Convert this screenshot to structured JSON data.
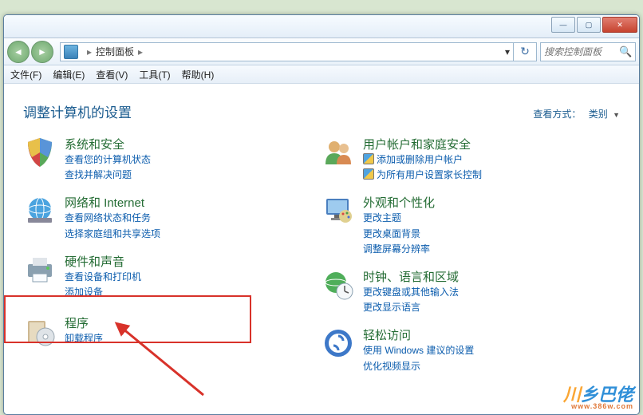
{
  "titlebar": {
    "min": "—",
    "max": "▢",
    "close": "✕"
  },
  "nav": {
    "back": "◄",
    "forward": "►",
    "path_root": "控制面板",
    "path_sep": "▸",
    "dropdown": "▾",
    "refresh": "↻",
    "search_placeholder": "搜索控制面板",
    "search_icon": "🔍"
  },
  "menu": {
    "file": "文件(F)",
    "edit": "编辑(E)",
    "view": "查看(V)",
    "tools": "工具(T)",
    "help": "帮助(H)"
  },
  "header": {
    "title": "调整计算机的设置",
    "view_label": "查看方式：",
    "view_mode": "类别",
    "dd": "▼"
  },
  "cats": {
    "system": {
      "title": "系统和安全",
      "sub1": "查看您的计算机状态",
      "sub2": "查找并解决问题"
    },
    "network": {
      "title": "网络和 Internet",
      "sub1": "查看网络状态和任务",
      "sub2": "选择家庭组和共享选项"
    },
    "hardware": {
      "title": "硬件和声音",
      "sub1": "查看设备和打印机",
      "sub2": "添加设备"
    },
    "programs": {
      "title": "程序",
      "sub1": "卸载程序"
    },
    "users": {
      "title": "用户帐户和家庭安全",
      "sub1": "添加或删除用户帐户",
      "sub2": "为所有用户设置家长控制"
    },
    "appearance": {
      "title": "外观和个性化",
      "sub1": "更改主题",
      "sub2": "更改桌面背景",
      "sub3": "调整屏幕分辨率"
    },
    "clock": {
      "title": "时钟、语言和区域",
      "sub1": "更改键盘或其他输入法",
      "sub2": "更改显示语言"
    },
    "ease": {
      "title": "轻松访问",
      "sub1": "使用 Windows 建议的设置",
      "sub2": "优化视频显示"
    }
  },
  "watermark": {
    "main": "乡巴佬",
    "small": "www.386w.com"
  }
}
